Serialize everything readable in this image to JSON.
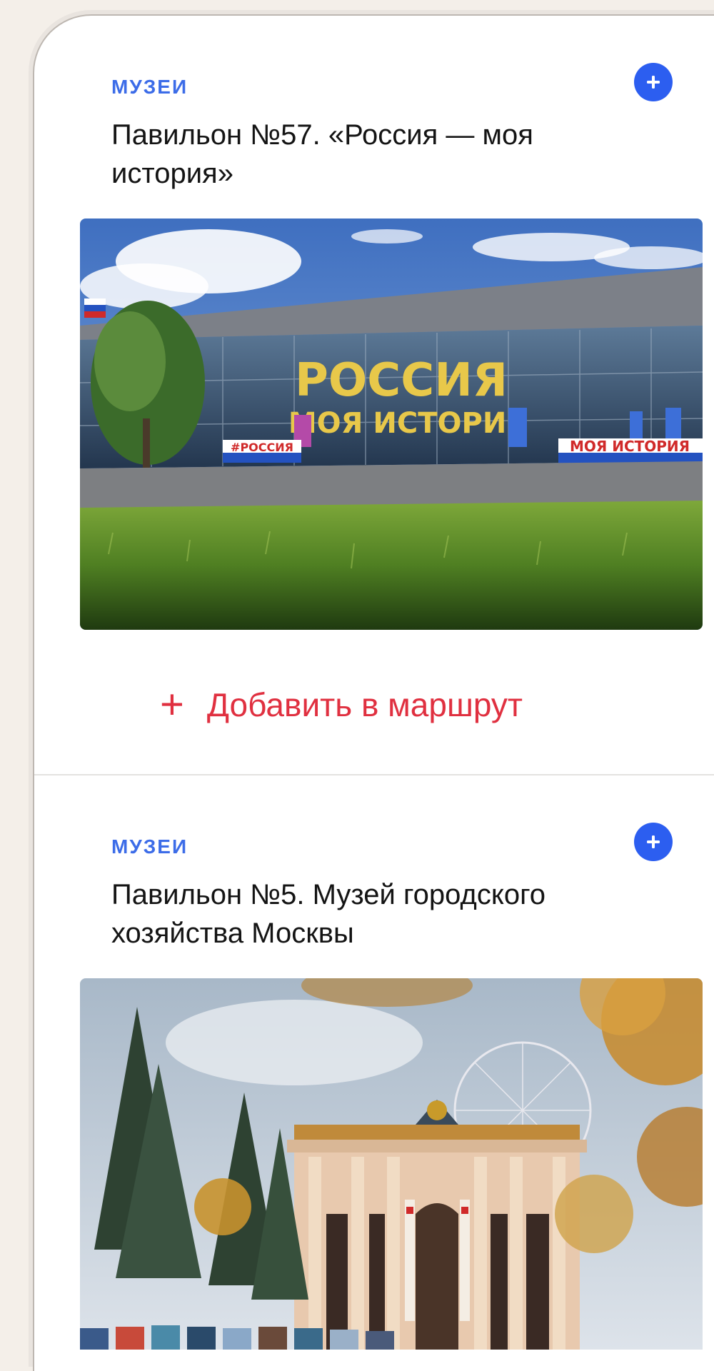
{
  "cards": [
    {
      "category": "МУЗЕИ",
      "title": "Павильон №57. «Россия — моя история»",
      "add_route_label": "Добавить в маршрут",
      "photo_signs": [
        "РОССИЯ",
        "МОЯ ИСТОРИЯ",
        "#РОССИЯ",
        "МОЯ ИСТОРИЯ"
      ]
    },
    {
      "category": "МУЗЕИ",
      "title": "Павильон №5. Музей городского хозяйства Москвы"
    }
  ],
  "icons": {
    "add": "plus-circle-icon",
    "route_add": "plus-icon"
  },
  "colors": {
    "accent_blue": "#2c5ef0",
    "category_blue": "#3c6ce8",
    "action_red": "#e03040"
  }
}
